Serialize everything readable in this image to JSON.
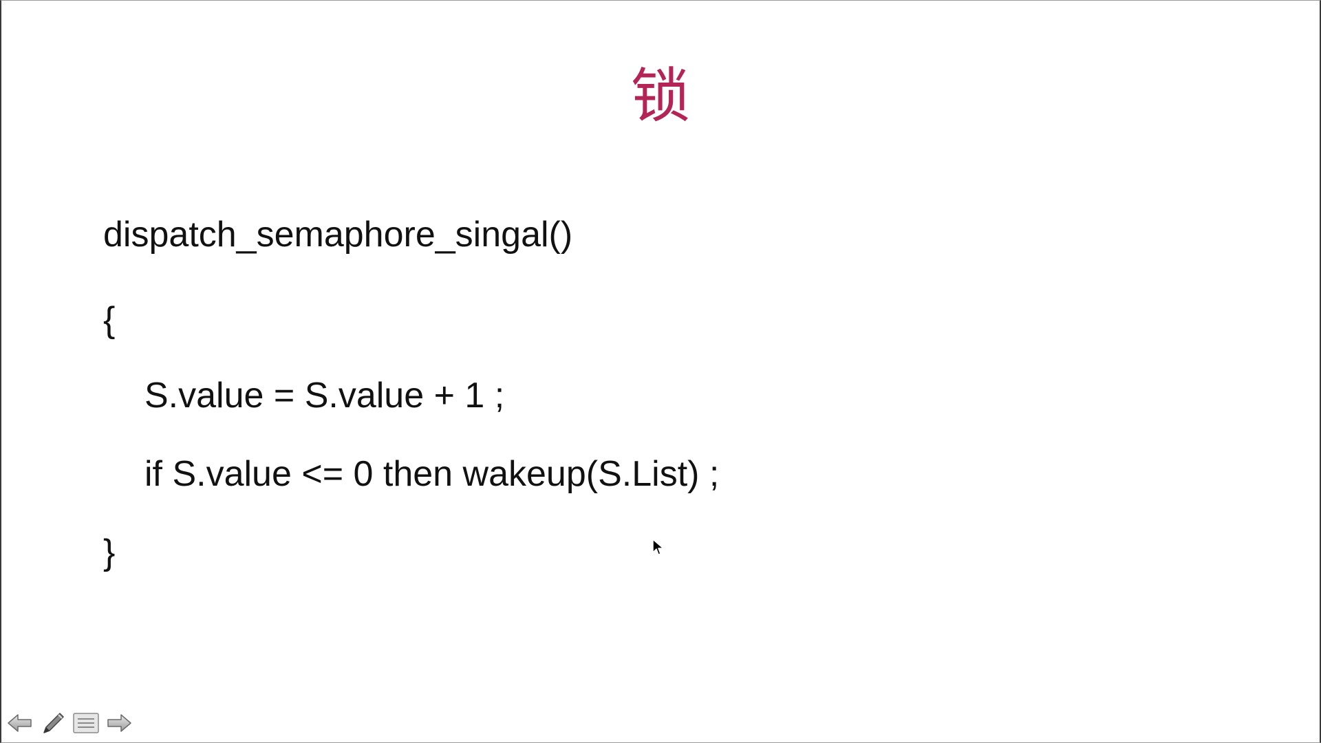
{
  "slide": {
    "title": "锁",
    "code_lines": [
      "dispatch_semaphore_singal()",
      "{",
      "S.value = S.value + 1 ;",
      "if S.value <= 0 then wakeup(S.List) ;",
      "}"
    ]
  },
  "colors": {
    "title": "#b32457",
    "text": "#111111",
    "background": "#ffffff"
  },
  "controls": [
    {
      "icon": "arrow-left-icon"
    },
    {
      "icon": "pen-icon"
    },
    {
      "icon": "menu-icon"
    },
    {
      "icon": "arrow-right-icon"
    }
  ]
}
